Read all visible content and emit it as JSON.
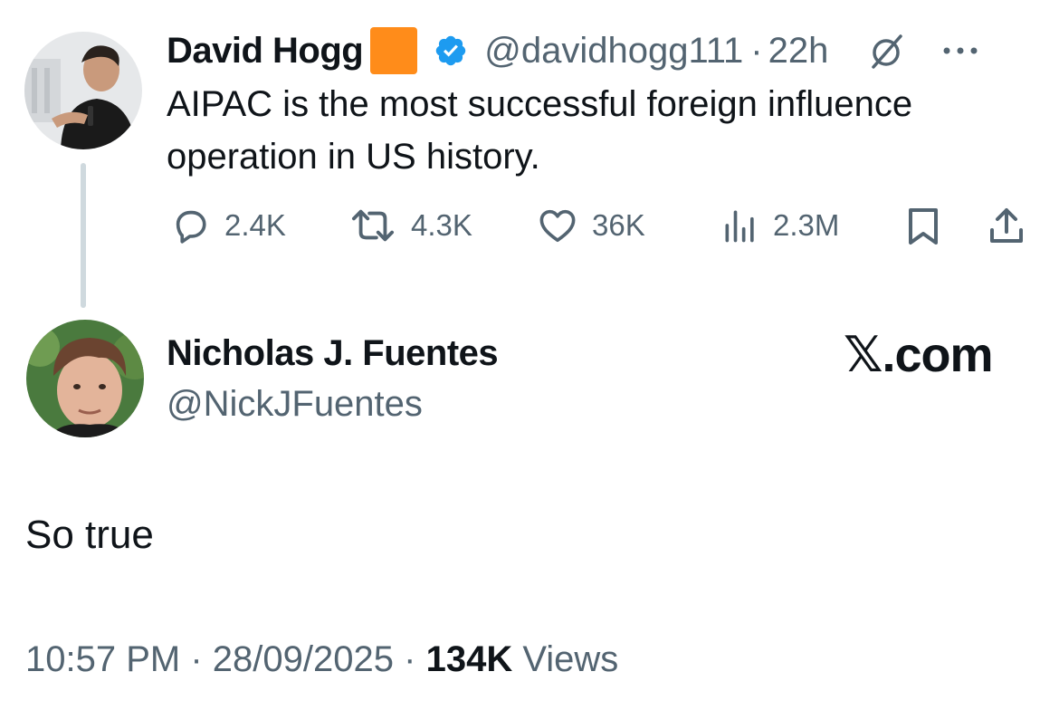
{
  "quoted_tweet": {
    "author_name": "David Hogg",
    "handle": "@davidhogg111",
    "separator": "·",
    "time": "22h",
    "more_label": "···",
    "text": "AIPAC is the most successful foreign influence operation in US history.",
    "stats": {
      "replies": "2.4K",
      "reposts": "4.3K",
      "likes": "36K",
      "views": "2.3M"
    },
    "badge_color": "#ff8c1a",
    "verified_color": "#1d9bf0"
  },
  "main_tweet": {
    "author_name": "Nicholas J. Fuentes",
    "handle": "@NickJFuentes",
    "brand": "𝕏.com",
    "text": "So true",
    "footer": {
      "time": "10:57 PM",
      "dot": "·",
      "date": "28/09/2025",
      "view_count": "134K",
      "views_label": "Views"
    }
  },
  "colors": {
    "text": "#0f1419",
    "muted": "#536471",
    "thread_line": "#cfd9de"
  }
}
